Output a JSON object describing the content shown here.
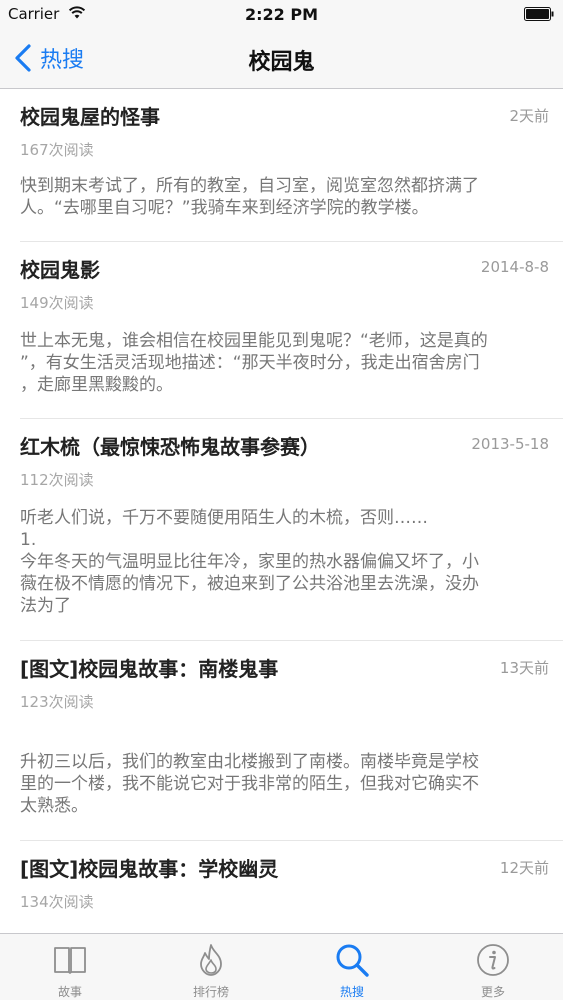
{
  "status_bar": {
    "carrier": "Carrier",
    "time": "2:22 PM"
  },
  "nav": {
    "back_label": "热搜",
    "title": "校园鬼"
  },
  "items": [
    {
      "title": "校园鬼屋的怪事",
      "date": "2天前",
      "reads": "167次阅读",
      "summary": "快到期末考试了，所有的教室，自习室，阅览室忽然都挤满了\n人。“去哪里自习呢？”我骑车来到经济学院的教学楼。"
    },
    {
      "title": "校园鬼影",
      "date": "2014-8-8",
      "reads": "149次阅读",
      "summary": "世上本无鬼，谁会相信在校园里能见到鬼呢？“老师，这是真的\n”，有女生活灵活现地描述：“那天半夜时分，我走出宿舍房门\n，走廊里黑黢黢的。"
    },
    {
      "title": "红木梳（最惊悚恐怖鬼故事参赛）",
      "date": "2013-5-18",
      "reads": "112次阅读",
      "summary": "听老人们说，千万不要随便用陌生人的木梳，否则……\n1.\n今年冬天的气温明显比往年冷，家里的热水器偏偏又坏了，小\n薇在极不情愿的情况下，被迫来到了公共浴池里去洗澡，没办\n法为了"
    },
    {
      "title": "[图文]校园鬼故事：南楼鬼事",
      "date": "13天前",
      "reads": "123次阅读",
      "summary": "升初三以后，我们的教室由北楼搬到了南楼。南楼毕竟是学校\n里的一个楼，我不能说它对于我非常的陌生，但我对它确实不\n太熟悉。"
    },
    {
      "title": "[图文]校园鬼故事：学校幽灵",
      "date": "12天前",
      "reads": "134次阅读",
      "summary": ""
    }
  ],
  "tabs": [
    {
      "label": "故事",
      "icon": "book-icon"
    },
    {
      "label": "排行榜",
      "icon": "flame-icon"
    },
    {
      "label": "热搜",
      "icon": "search-icon"
    },
    {
      "label": "更多",
      "icon": "info-icon"
    }
  ],
  "colors": {
    "accent": "#1a7cf2",
    "title": "#222222",
    "summary": "#777777",
    "meta": "#9a9a9a"
  }
}
